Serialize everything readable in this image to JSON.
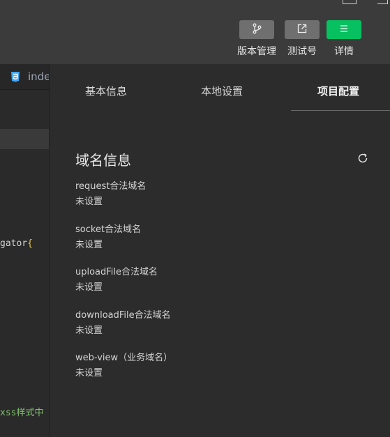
{
  "toolbar": {
    "buttons": [
      {
        "label": "版本管理",
        "icon": "branch-icon"
      },
      {
        "label": "测试号",
        "icon": "external-link-icon"
      },
      {
        "label": "详情",
        "icon": "menu-icon",
        "accent": "#07c160"
      }
    ]
  },
  "editor": {
    "tab_name": "inde",
    "file_icon": "css3-icon",
    "lines": [
      "gator{",
      "xss样式中"
    ]
  },
  "panel": {
    "tabs": [
      {
        "label": "基本信息",
        "active": false
      },
      {
        "label": "本地设置",
        "active": false
      },
      {
        "label": "项目配置",
        "active": true
      }
    ],
    "section_title": "域名信息",
    "refresh_icon": "refresh-icon",
    "fields": [
      {
        "label": "request合法域名",
        "value": "未设置"
      },
      {
        "label": "socket合法域名",
        "value": "未设置"
      },
      {
        "label": "uploadFile合法域名",
        "value": "未设置"
      },
      {
        "label": "downloadFile合法域名",
        "value": "未设置"
      },
      {
        "label": "web-view（业务域名）",
        "value": "未设置"
      }
    ]
  }
}
